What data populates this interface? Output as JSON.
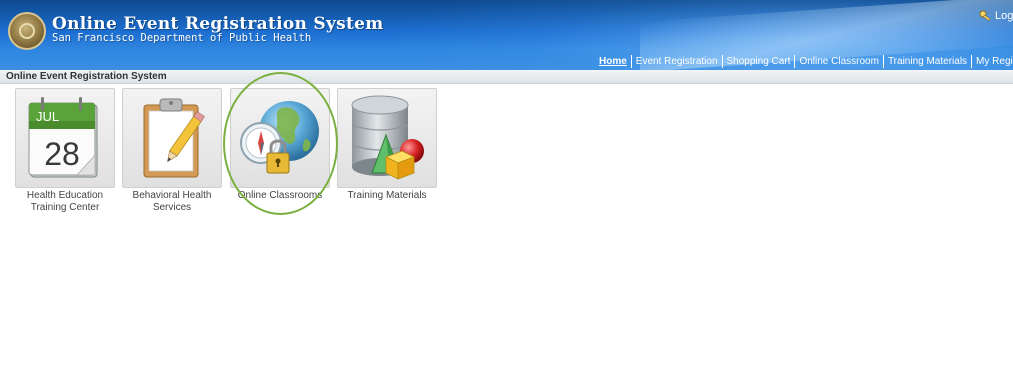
{
  "header": {
    "title": "Online Event Registration System",
    "subtitle": "San Francisco Department of Public Health",
    "login_label": "Logi"
  },
  "nav": {
    "items": [
      {
        "label": "Home",
        "active": true
      },
      {
        "label": "Event Registration"
      },
      {
        "label": "Shopping Cart"
      },
      {
        "label": "Online Classroom"
      },
      {
        "label": "Training Materials"
      },
      {
        "label": "My Registrations"
      }
    ]
  },
  "breadcrumb": "Online Event Registration System",
  "tiles": [
    {
      "label_line1": "Health Education",
      "label_line2": "Training Center",
      "icon": "calendar-icon",
      "calendar_month": "JUL",
      "calendar_day": "28"
    },
    {
      "label_line1": "Behavioral Health",
      "label_line2": "Services",
      "icon": "clipboard-icon"
    },
    {
      "label_line1": "Online Classrooms",
      "label_line2": "",
      "icon": "globe-lock-icon"
    },
    {
      "label_line1": "Training Materials",
      "label_line2": "",
      "icon": "database-icon"
    }
  ],
  "colors": {
    "header_blue": "#1c6ed0",
    "highlight_green": "#7bb040"
  }
}
